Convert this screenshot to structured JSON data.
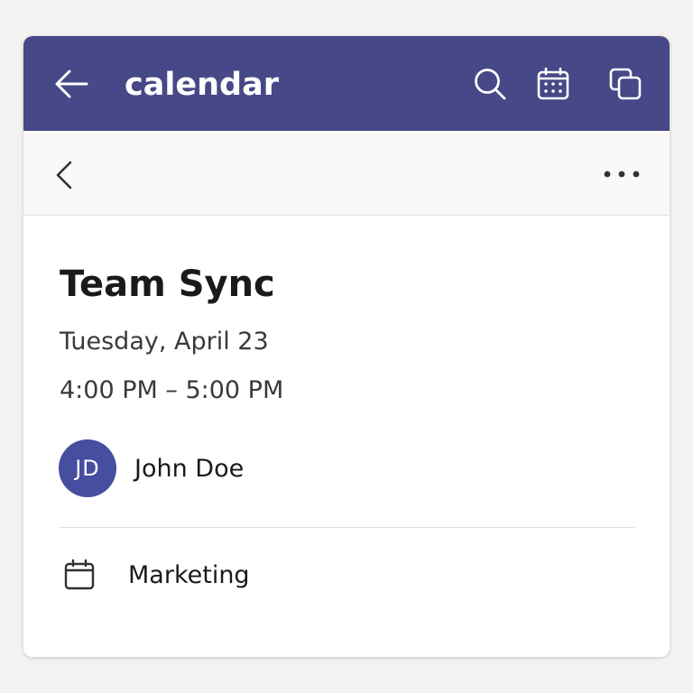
{
  "appbar": {
    "title": "calendar",
    "back_icon": "arrow-left-icon",
    "search_icon": "search-icon",
    "calendar_icon": "calendar-grid-icon",
    "popout_icon": "open-in-new-window-icon",
    "background_color": "#464887"
  },
  "subbar": {
    "back_icon": "chevron-left-icon",
    "more_icon": "more-horizontal-icon"
  },
  "event": {
    "title": "Team Sync",
    "date": "Tuesday, April 23",
    "time": "4:00 PM – 5:00 PM",
    "organizer": {
      "initials": "JD",
      "name": "John Doe",
      "avatar_color": "#464ea0"
    },
    "calendar": {
      "icon": "calendar-icon",
      "name": "Marketing"
    }
  }
}
